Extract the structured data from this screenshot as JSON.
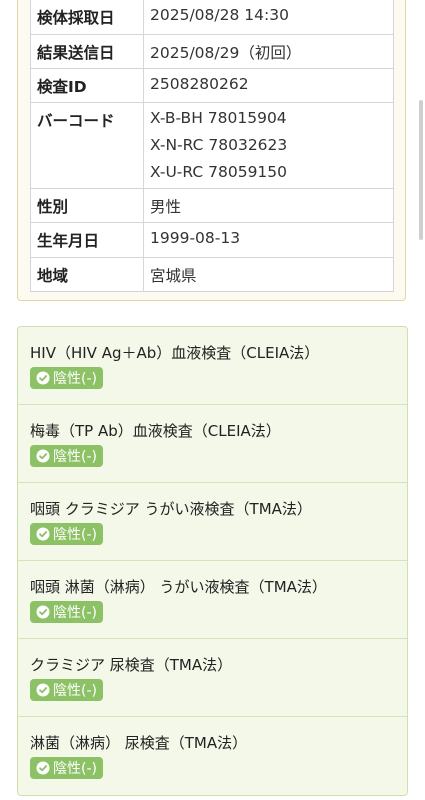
{
  "info": {
    "rows": [
      {
        "label": "検体採取日",
        "value": "2025/08/28  14:30"
      },
      {
        "label": "結果送信日",
        "value": "2025/08/29（初回）"
      },
      {
        "label": "検査ID",
        "value": "2508280262"
      },
      {
        "label": "バーコード",
        "values": [
          "X-B-BH  78015904",
          "X-N-RC  78032623",
          "X-U-RC  78059150"
        ]
      },
      {
        "label": "性別",
        "value": "男性"
      },
      {
        "label": "生年月日",
        "value": "1999-08-13"
      },
      {
        "label": "地域",
        "value": "宮城県"
      }
    ]
  },
  "results": [
    {
      "name": "HIV（HIV Ag＋Ab）血液検査（CLEIA法）",
      "status": "陰性(-)"
    },
    {
      "name": "梅毒（TP Ab）血液検査（CLEIA法）",
      "status": "陰性(-)"
    },
    {
      "name": "咽頭 クラミジア うがい液検査（TMA法）",
      "status": "陰性(-)"
    },
    {
      "name": "咽頭 淋菌（淋病） うがい液検査（TMA法）",
      "status": "陰性(-)"
    },
    {
      "name": "クラミジア 尿検査（TMA法）",
      "status": "陰性(-)"
    },
    {
      "name": "淋菌（淋病） 尿検査（TMA法）",
      "status": "陰性(-)"
    }
  ],
  "colors": {
    "badge": "#8cc265",
    "info_border": "#e2d5a8",
    "results_bg": "#f3f8e9"
  },
  "icons": {
    "status": "check-circle-icon"
  }
}
